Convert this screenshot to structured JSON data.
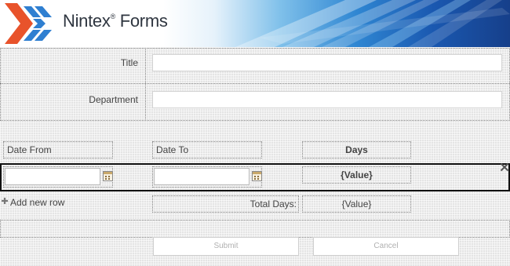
{
  "banner": {
    "brand_name": "Nintex",
    "brand_product": "Forms",
    "trademark": "®"
  },
  "fields": {
    "title_label": "Title",
    "title_value": "",
    "department_label": "Department",
    "department_value": ""
  },
  "table": {
    "headers": {
      "date_from": "Date From",
      "date_to": "Date To",
      "days": "Days"
    },
    "row": {
      "date_from": "",
      "date_to": "",
      "days": "{Value}"
    },
    "add_row_label": "Add new row",
    "total_label": "Total Days:",
    "total_value": "{Value}"
  },
  "buttons": {
    "submit": "Submit",
    "cancel": "Cancel"
  },
  "icons": {
    "brand_logo": "nintex-logo-icon",
    "calendar": "calendar-icon",
    "add": "plus-icon",
    "delete": "close-icon"
  },
  "colors": {
    "banner_blue": "#1a58b0",
    "logo_orange": "#e8532b",
    "logo_blue": "#2f7fd1",
    "repeating_border": "#111111"
  }
}
